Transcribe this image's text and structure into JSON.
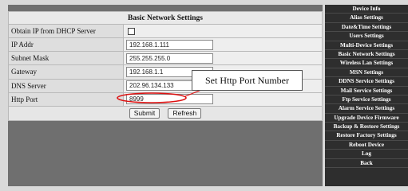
{
  "form": {
    "title": "Basic Network Settings",
    "rows": [
      {
        "label": "Obtain IP from DHCP Server",
        "type": "checkbox",
        "value": ""
      },
      {
        "label": "IP Addr",
        "type": "text",
        "value": "192.168.1.111"
      },
      {
        "label": "Subnet Mask",
        "type": "text",
        "value": "255.255.255.0"
      },
      {
        "label": "Gateway",
        "type": "text",
        "value": "192.168.1.1"
      },
      {
        "label": "DNS Server",
        "type": "text",
        "value": "202.96.134.133"
      },
      {
        "label": "Http Port",
        "type": "text",
        "value": "8999"
      }
    ],
    "submit_label": "Submit",
    "refresh_label": "Refresh"
  },
  "callout": {
    "text": "Set Http Port Number"
  },
  "sidebar": {
    "items": [
      {
        "label": "Device Info"
      },
      {
        "label": "Alias Settings"
      },
      {
        "label": "Date&Time Settings"
      },
      {
        "label": "Users Settings"
      },
      {
        "label": "Multi-Device Settings"
      },
      {
        "label": "Basic Network Settings"
      },
      {
        "label": "Wireless Lan Settings"
      },
      {
        "label": "MSN Settings"
      },
      {
        "label": "DDNS Service Settings"
      },
      {
        "label": "Mail Service Settings"
      },
      {
        "label": "Ftp Service Settings"
      },
      {
        "label": "Alarm Service Settings"
      },
      {
        "label": "Upgrade Device Firmware"
      },
      {
        "label": "Backup & Restore Settings"
      },
      {
        "label": "Restore Factory Settings"
      },
      {
        "label": "Reboot Device"
      },
      {
        "label": "Log"
      },
      {
        "label": "Back"
      }
    ]
  }
}
